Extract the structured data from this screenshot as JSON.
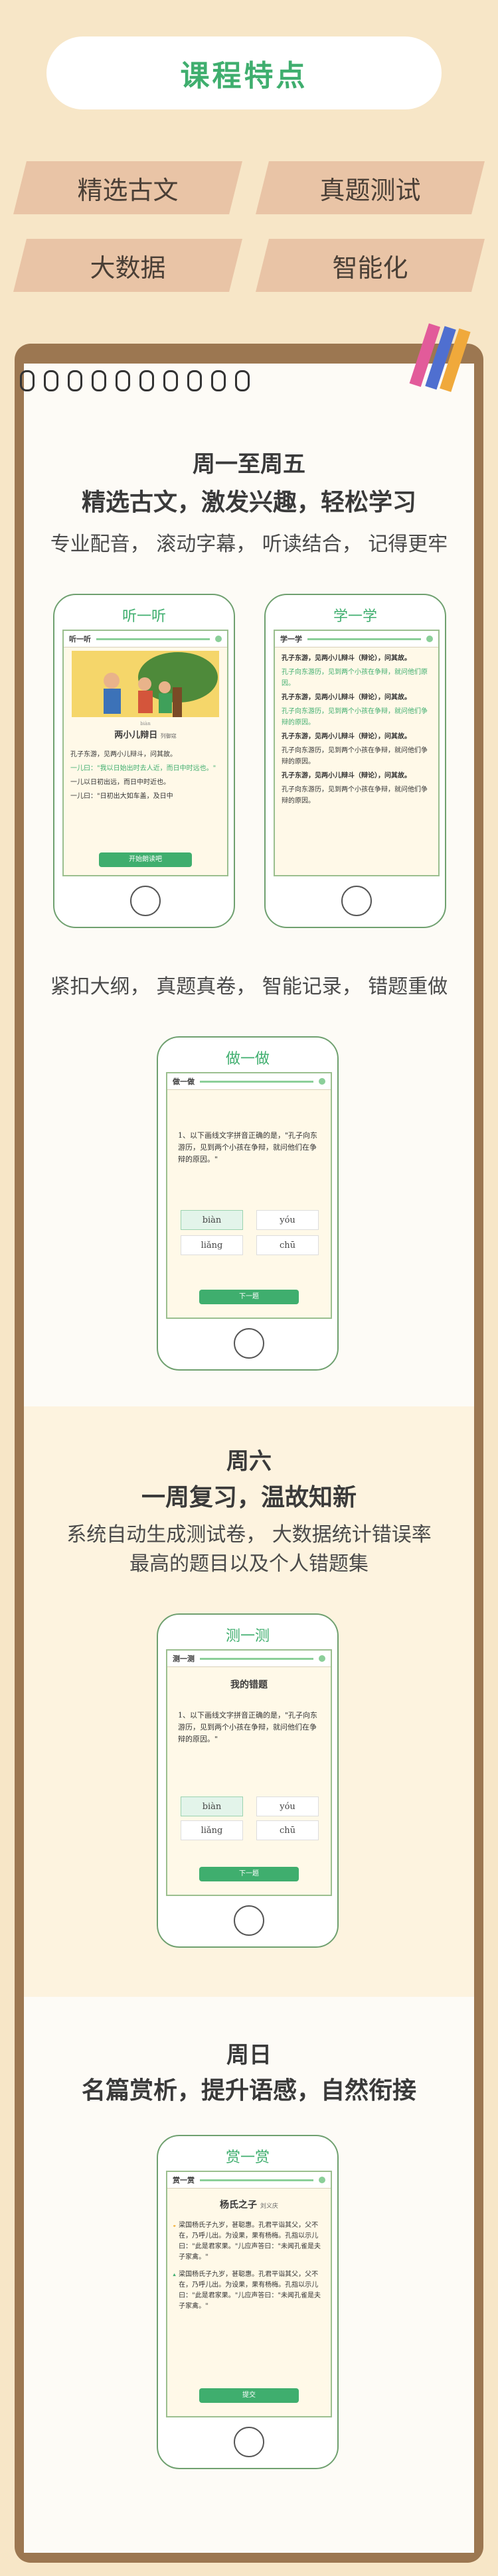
{
  "header": {
    "title": "课程特点"
  },
  "tags": [
    "精选古文",
    "真题测试",
    "大数据",
    "智能化"
  ],
  "weekday": {
    "title": "周一至周五",
    "subtitle": "精选古文，激发兴趣，轻松学习",
    "desc": "专业配音， 滚动字幕， 听读结合， 记得更牢",
    "listen_phone": {
      "title": "听一听",
      "head": "听一听",
      "story_title": "两小儿辩日",
      "story_author": "列御寇",
      "pinyin_hint": "biàn",
      "lines": [
        "孔子东游，见两小儿辩斗，问其故。",
        "一儿曰：\"我以日始出时去人近，而日中时远也。\"",
        "一儿以日初出远，而日中时近也。",
        "一儿曰：\"日初出大如车盖，及日中"
      ],
      "button": "开始朗读吧"
    },
    "learn_phone": {
      "title": "学一学",
      "head": "学一学",
      "lines": [
        "孔子东游，见两小儿辩斗（辩论），问其故。",
        "孔子向东游历，见到两个小孩在争辩，就问他们原因。",
        "孔子东游，见两小儿辩斗（辩论），问其故。",
        "孔子向东游历，见到两个小孩在争辩，就问他们争辩的原因。",
        "孔子东游，见两小儿辩斗（辩论），问其故。",
        "孔子向东游历，见到两个小孩在争辩，就问他们争辩的原因。",
        "孔子东游，见两小儿辩斗（辩论），问其故。",
        "孔子向东游历，见到两个小孩在争辩，就问他们争辩的原因。"
      ]
    },
    "desc2": "紧扣大纲， 真题真卷， 智能记录， 错题重做",
    "practice_phone": {
      "title": "做一做",
      "head": "做一做",
      "question": "1、以下画线文字拼音正确的是，\"孔子向东游历，见到两个小孩在争辩，就问他们在争辩的原因。\"",
      "options": [
        "biàn",
        "yóu",
        "liǎng",
        "chū"
      ],
      "button": "下一题"
    }
  },
  "saturday": {
    "title": "周六",
    "subtitle": "一周复习，温故知新",
    "desc_line1": "系统自动生成测试卷， 大数据统计错误率",
    "desc_line2": "最高的题目以及个人错题集",
    "test_phone": {
      "title": "测一测",
      "head": "测一测",
      "sub": "我的错题",
      "question": "1、以下画线文字拼音正确的是，\"孔子向东游历，见到两个小孩在争辩，就问他们在争辩的原因。\"",
      "options": [
        "biàn",
        "yóu",
        "liǎng",
        "chū"
      ],
      "button": "下一题"
    }
  },
  "sunday": {
    "title": "周日",
    "subtitle": "名篇赏析，提升语感，自然衔接",
    "enjoy_phone": {
      "title": "赏一赏",
      "head": "赏一赏",
      "story_title": "杨氏之子",
      "story_author": "刘义庆",
      "para1": "梁国杨氏子九岁，甚聪惠。孔君平诣其父，父不在，乃呼儿出。为设果，果有杨梅。孔指以示儿曰：\"此是君家果。\"儿应声答曰：\"未闻孔雀是夫子家禽。\"",
      "para2": "梁国杨氏子九岁，甚聪惠。孔君平诣其父，父不在，乃呼儿出。为设果，果有杨梅。孔指以示儿曰：\"此是君家果。\"儿应声答曰：\"未闻孔雀是夫子家禽。\"",
      "button": "提交"
    }
  }
}
